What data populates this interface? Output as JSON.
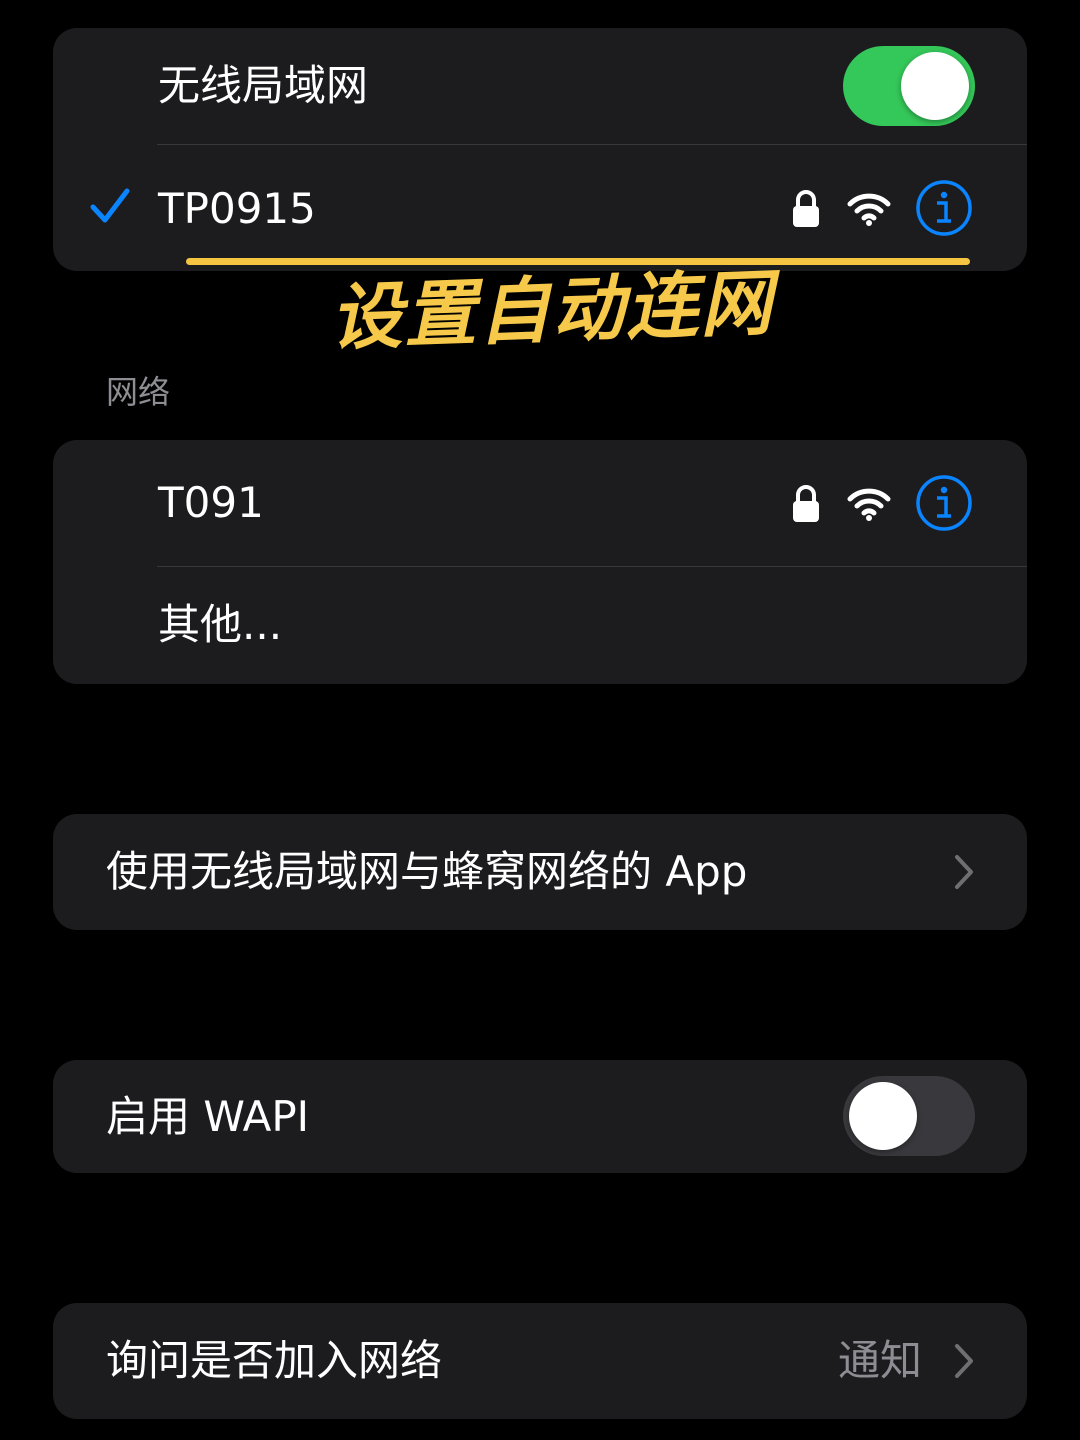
{
  "wifi_card": {
    "title": "无线局域网",
    "toggle_on": true,
    "toggle_color": "#34c759",
    "connected_network": "TP0915"
  },
  "annotation": {
    "text": "设置自动连网",
    "color": "#f6c94a"
  },
  "networks_section": {
    "header": "网络",
    "items": [
      {
        "name": "T091"
      },
      {
        "name": "其他..."
      }
    ]
  },
  "apps_row": {
    "label": "使用无线局域网与蜂窝网络的 App"
  },
  "wapi_row": {
    "label": "启用 WAPI",
    "toggle_on": false,
    "toggle_color": "#39393d"
  },
  "ask_join_row": {
    "label": "询问是否加入网络",
    "value": "通知"
  },
  "colors": {
    "accent_blue": "#0a84ff",
    "card_bg": "#1c1c1e",
    "background": "#000000",
    "secondary_text": "#8d8d93"
  }
}
